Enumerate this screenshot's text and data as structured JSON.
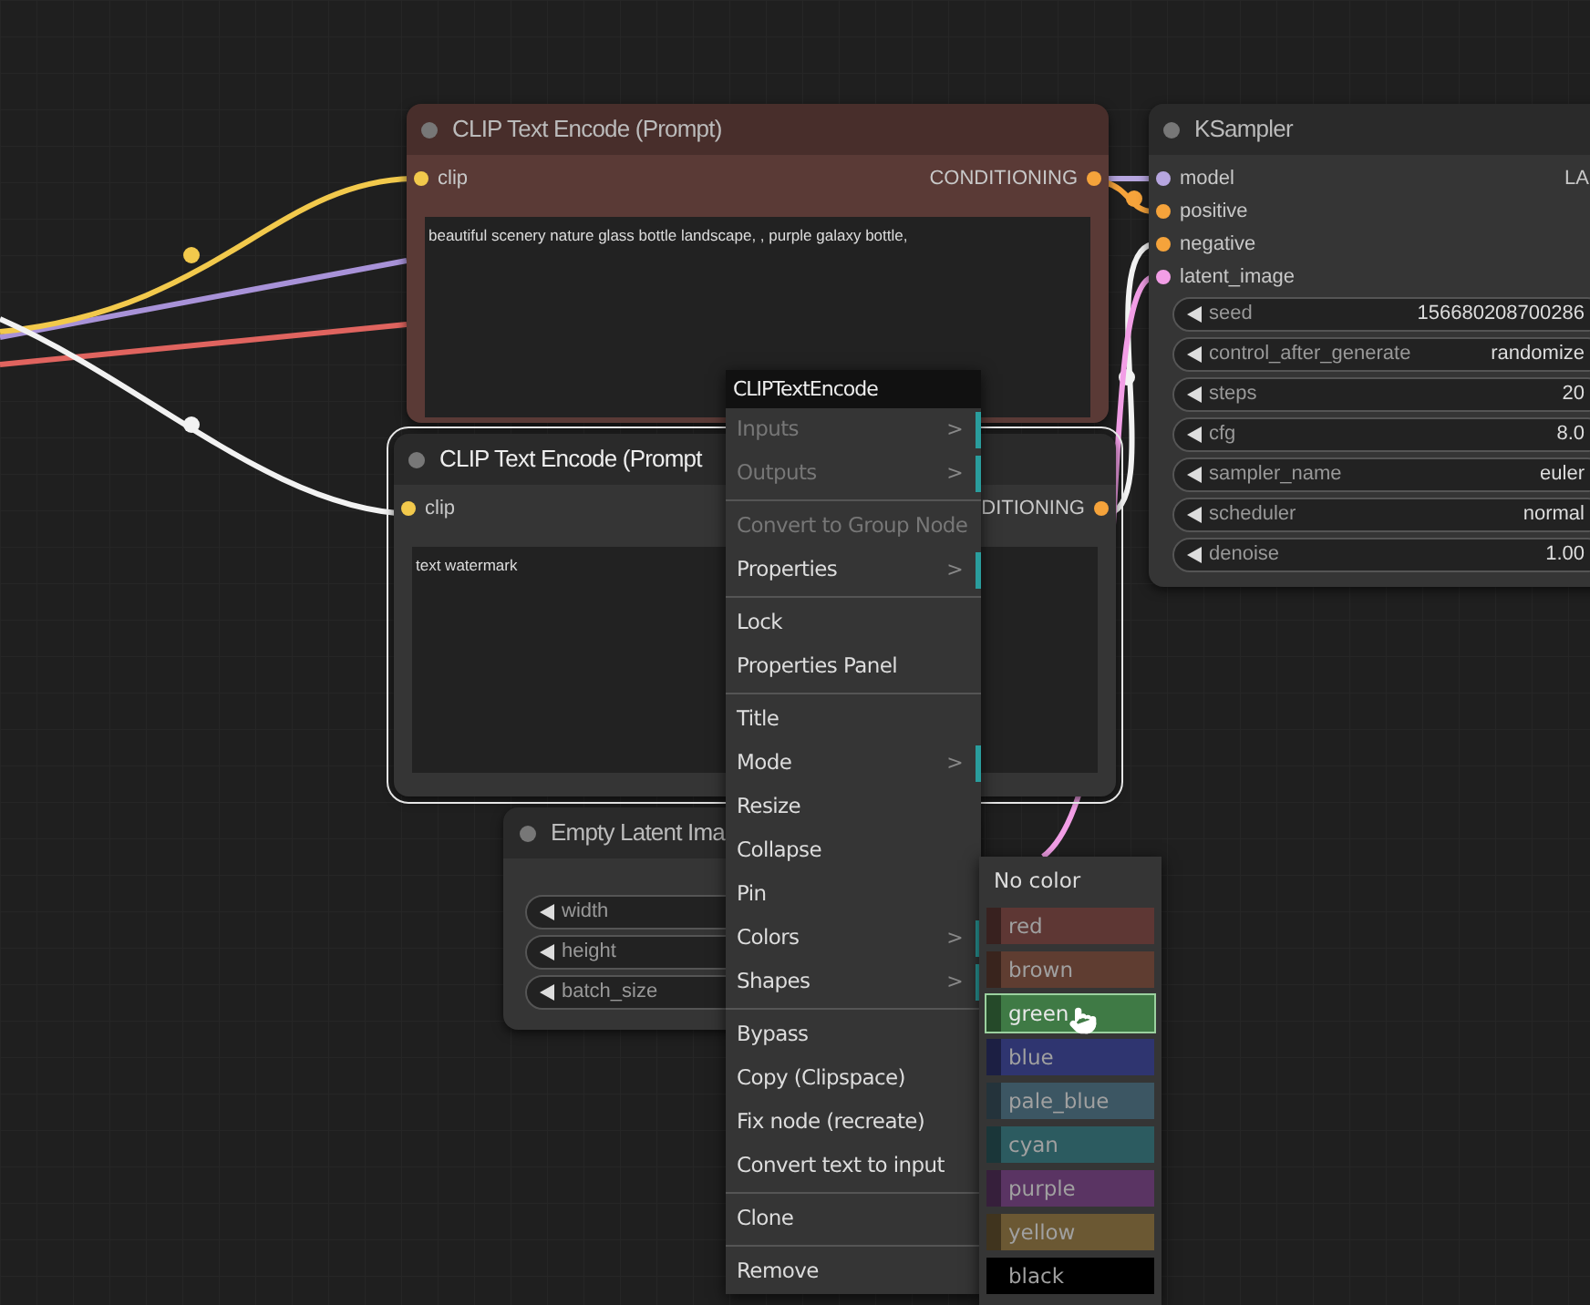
{
  "nodes": [
    {
      "kind": "text_encode",
      "title": "CLIP Text Encode (Prompt)",
      "color": "#5a3a36",
      "selected": false,
      "inputs": [
        {
          "label": "clip",
          "color": "#f2c94c"
        }
      ],
      "outputs": [
        {
          "label": "CONDITIONING",
          "color": "#f5a33b"
        }
      ],
      "text": "beautiful scenery nature glass bottle landscape, , purple galaxy bottle,"
    },
    {
      "kind": "text_encode",
      "title": "CLIP Text Encode (Prompt",
      "color": "#353535",
      "selected": true,
      "inputs": [
        {
          "label": "clip",
          "color": "#f2c94c"
        }
      ],
      "outputs": [
        {
          "label": "DITIONING",
          "color": "#f5a33b"
        }
      ],
      "text": "text watermark"
    },
    {
      "kind": "latent",
      "title": "Empty Latent Ima",
      "color": "#353535",
      "selected": false,
      "widgets": [
        {
          "label": "width"
        },
        {
          "label": "height"
        },
        {
          "label": "batch_size"
        }
      ]
    },
    {
      "kind": "sampler",
      "title": "KSampler",
      "color": "#353535",
      "selected": false,
      "inputs": [
        {
          "label": "model",
          "color": "#b7a6e0"
        },
        {
          "label": "positive",
          "color": "#f5a33b"
        },
        {
          "label": "negative",
          "color": "#f5a33b"
        },
        {
          "label": "latent_image",
          "color": "#f29ee6"
        }
      ],
      "outputs": [
        {
          "label": "LA"
        }
      ],
      "widgets": [
        {
          "label": "seed",
          "value": "156680208700286"
        },
        {
          "label": "control_after_generate",
          "value": "randomize"
        },
        {
          "label": "steps",
          "value": "20"
        },
        {
          "label": "cfg",
          "value": "8.0"
        },
        {
          "label": "sampler_name",
          "value": "euler"
        },
        {
          "label": "scheduler",
          "value": "normal"
        },
        {
          "label": "denoise",
          "value": "1.00"
        }
      ]
    }
  ],
  "context_menu": {
    "title": "CLIPTextEncode",
    "groups": [
      [
        {
          "label": "Inputs",
          "disabled": true,
          "submenu": ">"
        },
        {
          "label": "Outputs",
          "disabled": true,
          "submenu": ">"
        }
      ],
      [
        {
          "label": "Convert to Group Node",
          "disabled": true
        },
        {
          "label": "Properties",
          "disabled": false,
          "submenu": ">"
        }
      ],
      [
        {
          "label": "Lock",
          "disabled": false
        },
        {
          "label": "Properties Panel",
          "disabled": false
        }
      ],
      [
        {
          "label": "Title",
          "disabled": false
        },
        {
          "label": "Mode",
          "disabled": false,
          "submenu": ">"
        },
        {
          "label": "Resize",
          "disabled": false
        },
        {
          "label": "Collapse",
          "disabled": false
        },
        {
          "label": "Pin",
          "disabled": false
        },
        {
          "label": "Colors",
          "disabled": false,
          "submenu": ">"
        },
        {
          "label": "Shapes",
          "disabled": false,
          "submenu": ">"
        }
      ],
      [
        {
          "label": "Bypass",
          "disabled": false
        },
        {
          "label": "Copy (Clipspace)",
          "disabled": false
        },
        {
          "label": "Fix node (recreate)",
          "disabled": false
        },
        {
          "label": "Convert text to input",
          "disabled": false
        }
      ],
      [
        {
          "label": "Clone",
          "disabled": false
        }
      ],
      [
        {
          "label": "Remove",
          "disabled": false
        }
      ]
    ]
  },
  "color_menu": {
    "title": "No color",
    "items": [
      {
        "label": "red",
        "color": "#5e3734",
        "selected": false
      },
      {
        "label": "brown",
        "color": "#5f3d31",
        "selected": false
      },
      {
        "label": "green",
        "color": "#3f7a45",
        "selected": true
      },
      {
        "label": "blue",
        "color": "#2f3570",
        "selected": false
      },
      {
        "label": "pale_blue",
        "color": "#3c5663",
        "selected": false
      },
      {
        "label": "cyan",
        "color": "#2c5b60",
        "selected": false
      },
      {
        "label": "purple",
        "color": "#5a3463",
        "selected": false
      },
      {
        "label": "yellow",
        "color": "#6b5833",
        "selected": false
      },
      {
        "label": "black",
        "color": "#000000",
        "selected": false
      }
    ]
  }
}
